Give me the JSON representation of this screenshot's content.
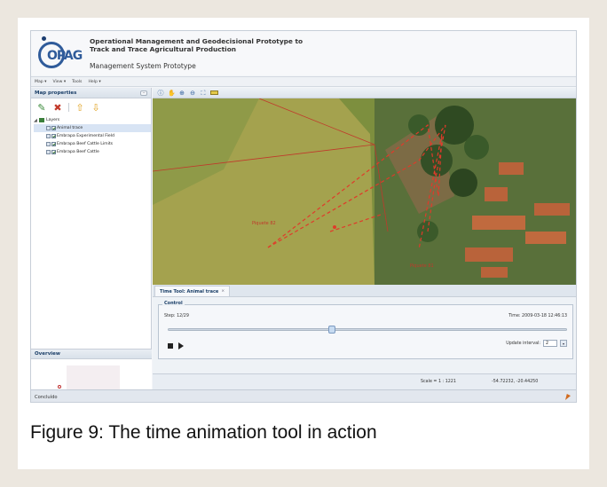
{
  "app": {
    "logo_text": "OPAG",
    "title_line1": "Operational Management and Geodecisional Prototype to",
    "title_line2": "Track and Trace Agricultural Production",
    "subtitle": "Management System Prototype",
    "menus": [
      {
        "label": "Map ▾"
      },
      {
        "label": "View ▾"
      },
      {
        "label": "Tools"
      },
      {
        "label": "Help ▾"
      }
    ],
    "colors": {
      "accent": "#2f5b9a",
      "trace": "#e03a2a",
      "panel_header": "#1b3f68"
    }
  },
  "map_properties": {
    "title": "Map properties",
    "collapse_glyph": "−",
    "tools": [
      {
        "icon": "add-layer-icon",
        "glyph": "✎"
      },
      {
        "icon": "remove-layer-icon",
        "glyph": "✖"
      },
      {
        "icon": "move-up-icon",
        "glyph": "⇧"
      },
      {
        "icon": "move-down-icon",
        "glyph": "⇩"
      }
    ],
    "root_toggle": "◢",
    "root_label": "Layers",
    "layers": [
      {
        "label": "Animal trace",
        "selected": true
      },
      {
        "label": "Embrapa Experimental Field",
        "selected": false
      },
      {
        "label": "Embrapa Beef Cattle Limits",
        "selected": false
      },
      {
        "label": "Embrapa Beef Cattle",
        "selected": false
      }
    ]
  },
  "overview": {
    "title": "Overview"
  },
  "map_toolbar": [
    {
      "icon": "info-icon",
      "glyph": "ⓘ"
    },
    {
      "icon": "pan-icon",
      "glyph": "✋"
    },
    {
      "icon": "zoom-in-icon",
      "glyph": "⊕"
    },
    {
      "icon": "zoom-out-icon",
      "glyph": "⊖"
    },
    {
      "icon": "zoom-extent-icon",
      "glyph": "⛶"
    }
  ],
  "map": {
    "labels": [
      {
        "text": "Piquete 82"
      },
      {
        "text": "Piquete 81"
      }
    ]
  },
  "time_tool": {
    "tab_label": "Time Tool: Animal trace",
    "tab_close": "×",
    "legend": "Control",
    "step": "Step: 12/29",
    "time": "Time: 2009-03-18 12:46:13",
    "progress_fraction": 0.41,
    "interval_label": "Update interval:",
    "interval_value": "2",
    "interval_arrow": "▾"
  },
  "scale": "Scale = 1 : 1221",
  "coords": "-54.72232, -20.44250",
  "status": "Concluído",
  "caption": "Figure 9: The time animation tool in action"
}
